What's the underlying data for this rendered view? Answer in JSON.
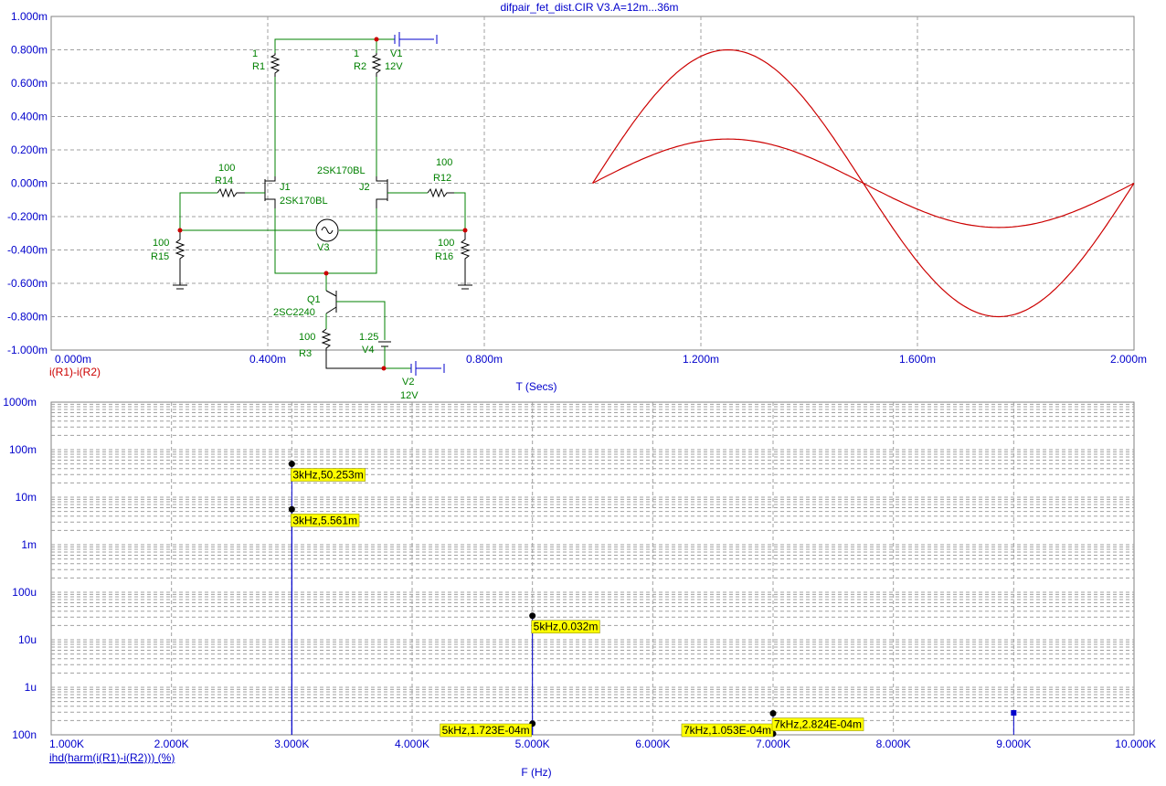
{
  "window": {
    "title": "difpair_fet_dist.CIR V3.A=12m...36m"
  },
  "colors": {
    "axis_text": "#0000cc",
    "trace": "#cc0000",
    "stem": "#0000cc",
    "schematic": "#008000",
    "grid": "#a0a0a0",
    "label_bg": "#ffff00"
  },
  "chart_data": [
    {
      "type": "line",
      "title": "difpair_fet_dist.CIR V3.A=12m...36m",
      "xlabel": "T (Secs)",
      "ylim": [
        -1.0,
        1.0
      ],
      "xlim": [
        0.0,
        2.0
      ],
      "x_ticks": [
        "0.000m",
        "0.400m",
        "0.800m",
        "1.200m",
        "1.600m",
        "2.000m"
      ],
      "y_ticks": [
        "1.000m",
        "0.800m",
        "0.600m",
        "0.400m",
        "0.200m",
        "0.000m",
        "-0.200m",
        "-0.400m",
        "-0.600m",
        "-0.800m",
        "-1.000m"
      ],
      "legend": "i(R1)-i(R2)",
      "series": [
        {
          "name": "i(R1)-i(R2)",
          "x_start": 1.0,
          "x_end": 2.0,
          "amplitude": 0.8
        },
        {
          "name": "i(R1)-i(R2)",
          "x_start": 1.0,
          "x_end": 2.0,
          "amplitude": 0.265
        }
      ]
    },
    {
      "type": "bar",
      "xlabel": "F (Hz)",
      "yscale": "log",
      "ylim": [
        "100n",
        "1000m"
      ],
      "xlim": [
        1000,
        10000
      ],
      "x_ticks": [
        "1.000K",
        "2.000K",
        "3.000K",
        "4.000K",
        "5.000K",
        "6.000K",
        "7.000K",
        "8.000K",
        "9.000K",
        "10.000K"
      ],
      "y_ticks": [
        "1000m",
        "100m",
        "10m",
        "1m",
        "100u",
        "10u",
        "1u",
        "100n"
      ],
      "legend": "ihd(harm(i(R1)-i(R2))) (%)",
      "stems": [
        {
          "x": 3000,
          "y": 0.050253
        },
        {
          "x": 3000,
          "y": 0.005561
        },
        {
          "x": 5000,
          "y": 3.2e-05
        },
        {
          "x": 5000,
          "y": 1.723e-07
        },
        {
          "x": 7000,
          "y": 2.824e-07
        },
        {
          "x": 7000,
          "y": 1.053e-07
        },
        {
          "x": 9000,
          "y": 2.9e-07
        }
      ],
      "annotations": [
        "3kHz,50.253m",
        "3kHz,5.561m",
        "5kHz,0.032m",
        "5kHz,1.723E-04m",
        "7kHz,1.053E-04m",
        "7kHz,2.824E-04m"
      ]
    }
  ],
  "schematic": {
    "labels": {
      "r1_val": "1",
      "r1": "R1",
      "r2_val": "1",
      "r2": "R2",
      "v1": "V1",
      "v1_val": "12V",
      "r14_val": "100",
      "r14": "R14",
      "j1": "J1",
      "j1_part": "2SK170BL",
      "j2_part": "2SK170BL",
      "j2": "J2",
      "r12_val": "100",
      "r12": "R12",
      "v3": "V3",
      "r15_val": "100",
      "r15": "R15",
      "r16_val": "100",
      "r16": "R16",
      "q1": "Q1",
      "q1_part": "2SC2240",
      "r3_val": "100",
      "r3": "R3",
      "v4_val": "1.25",
      "v4": "V4",
      "v2": "V2",
      "v2_val": "12V"
    }
  }
}
